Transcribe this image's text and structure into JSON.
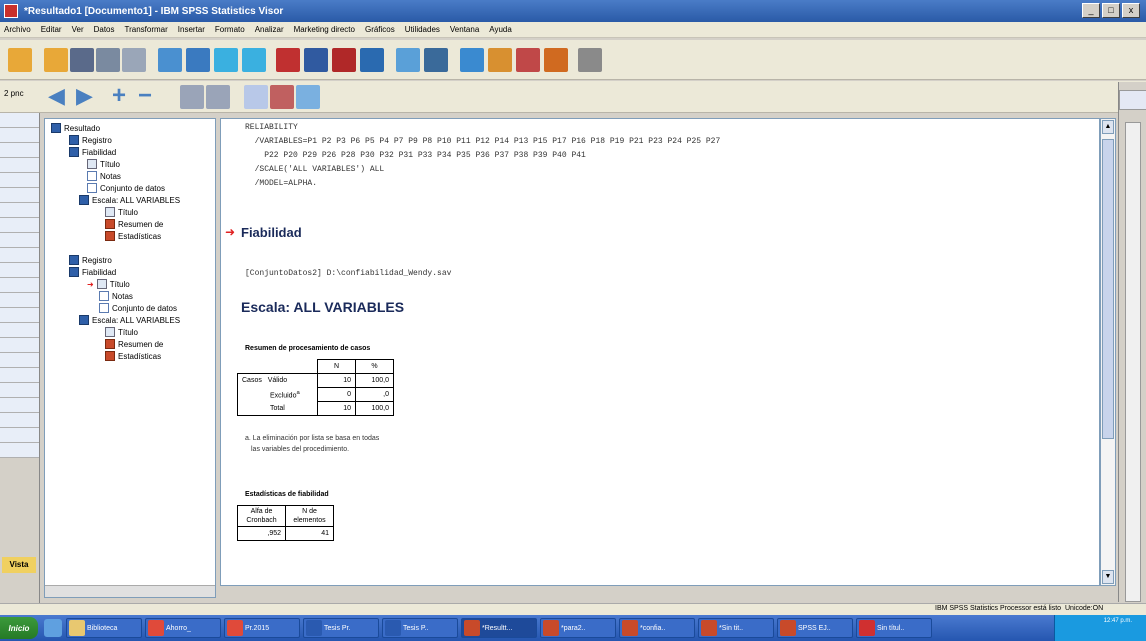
{
  "window": {
    "title": "*Resultado1 [Documento1] - IBM SPSS Statistics Visor",
    "controls": [
      "_",
      "□",
      "x"
    ]
  },
  "menu": [
    "Archivo",
    "Editar",
    "Ver",
    "Datos",
    "Transformar",
    "Insertar",
    "Formato",
    "Analizar",
    "Marketing directo",
    "Gráficos",
    "Utilidades",
    "Ventana",
    "Ayuda"
  ],
  "left_strip": {
    "label": "Vista"
  },
  "outline": {
    "nodes": [
      {
        "label": "Resultado"
      },
      {
        "label": "Registro"
      },
      {
        "label": "Fiabilidad"
      },
      {
        "label": "Título"
      },
      {
        "label": "Notas"
      },
      {
        "label": "Conjunto de datos"
      },
      {
        "label": "Escala: ALL VARIABLES"
      },
      {
        "label": "Título"
      },
      {
        "label": "Resumen de"
      },
      {
        "label": "Estadísticas"
      },
      {
        "label": "Registro"
      },
      {
        "label": "Fiabilidad"
      },
      {
        "label": "Título"
      },
      {
        "label": "Notas"
      },
      {
        "label": "Conjunto de datos"
      },
      {
        "label": "Escala: ALL VARIABLES"
      },
      {
        "label": "Título"
      },
      {
        "label": "Resumen de"
      },
      {
        "label": "Estadísticas"
      }
    ]
  },
  "viewer": {
    "syntax": [
      "RELIABILITY",
      "  /VARIABLES=P1 P2 P3 P6 P5 P4 P7 P9 P8 P10 P11 P12 P14 P13 P15 P17 P16 P18 P19 P21 P23 P24 P25 P27",
      "    P22 P20 P29 P26 P28 P30 P32 P31 P33 P34 P35 P36 P37 P38 P39 P40 P41",
      "  /SCALE('ALL VARIABLES') ALL",
      "  /MODEL=ALPHA."
    ],
    "heading_fiabilidad": "Fiabilidad",
    "dataset_line": "[ConjuntoDatos2] D:\\confiabilidad_Wendy.sav",
    "heading_escala": "Escala: ALL VARIABLES",
    "case_table": {
      "title": "Resumen de procesamiento de casos",
      "col_n": "N",
      "col_pct": "%",
      "row_group": "Casos",
      "rows": [
        {
          "label": "Válido",
          "n": "10",
          "pct": "100,0"
        },
        {
          "label": "Excluido",
          "sup": "a",
          "n": "0",
          "pct": ",0"
        },
        {
          "label": "Total",
          "n": "10",
          "pct": "100,0"
        }
      ],
      "footnote_1": "a. La eliminación por lista se basa en todas",
      "footnote_2": "las variables del procedimiento."
    },
    "reliability_table": {
      "title": "Estadísticas de fiabilidad",
      "col_alpha_1": "Alfa de",
      "col_alpha_2": "Cronbach",
      "col_n_1": "N de",
      "col_n_2": "elementos",
      "alpha": ",952",
      "n_items": "41"
    }
  },
  "statusbar": {
    "processor": "IBM SPSS Statistics Processor está listo",
    "encoding": "Unicode:ON"
  },
  "taskbar": {
    "start": "Inicio",
    "tasks": [
      "Biblioteca",
      "Ahorro_",
      "Pr.2015",
      "Tesis Pr.",
      "Tesis P..",
      "*Resultt...",
      "*para2..",
      "*confia..",
      "*Sin tit..",
      "SPSS EJ..",
      "Sin títul.."
    ],
    "clock": "12:47 p.m."
  },
  "colors": {
    "title_blue": "#2a5aa7",
    "arrow_red": "#e02020",
    "heading_navy": "#1a2a5a"
  }
}
